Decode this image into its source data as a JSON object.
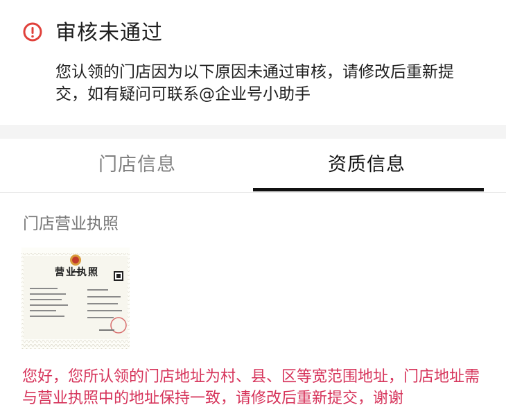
{
  "banner": {
    "status_icon": "exclamation-circle-icon",
    "title": "审核未通过",
    "description": "您认领的门店因为以下原因未通过审核，请修改后重新提交，如有疑问可联系@企业号小助手"
  },
  "tabs": [
    {
      "label": "门店信息",
      "active": false
    },
    {
      "label": "资质信息",
      "active": true
    }
  ],
  "section": {
    "label": "门店营业执照",
    "license_heading": "营业执照",
    "remark": "您好，您所认领的门店地址为村、县、区等宽范围地址，门店地址需与营业执照中的地址保持一致，请修改后重新提交，谢谢"
  },
  "colors": {
    "warning": "#e0403a",
    "remark": "#d6335a",
    "active_tab": "#111111",
    "inactive_tab": "#7f7f7f"
  }
}
